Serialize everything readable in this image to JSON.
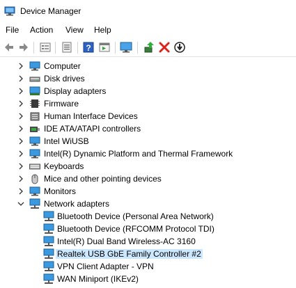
{
  "window": {
    "title": "Device Manager"
  },
  "menu": [
    "File",
    "Action",
    "View",
    "Help"
  ],
  "toolbar": [
    {
      "name": "back-icon"
    },
    {
      "name": "forward-icon"
    },
    {
      "name": "properties-icon"
    },
    {
      "name": "show-hidden-icon"
    },
    {
      "name": "help-icon"
    },
    {
      "name": "action-pane-icon"
    },
    {
      "name": "monitor-icon"
    },
    {
      "name": "update-driver-icon"
    },
    {
      "name": "uninstall-icon"
    },
    {
      "name": "disable-icon"
    }
  ],
  "tree": {
    "categories": [
      {
        "label": "Computer",
        "icon": "computer-icon",
        "expanded": false
      },
      {
        "label": "Disk drives",
        "icon": "disk-drive-icon",
        "expanded": false
      },
      {
        "label": "Display adapters",
        "icon": "display-adapter-icon",
        "expanded": false
      },
      {
        "label": "Firmware",
        "icon": "firmware-icon",
        "expanded": false
      },
      {
        "label": "Human Interface Devices",
        "icon": "hid-icon",
        "expanded": false
      },
      {
        "label": "IDE ATA/ATAPI controllers",
        "icon": "ide-controller-icon",
        "expanded": false
      },
      {
        "label": "Intel WiUSB",
        "icon": "intel-wiusb-icon",
        "expanded": false
      },
      {
        "label": "Intel(R) Dynamic Platform and Thermal Framework",
        "icon": "thermal-framework-icon",
        "expanded": false
      },
      {
        "label": "Keyboards",
        "icon": "keyboard-icon",
        "expanded": false
      },
      {
        "label": "Mice and other pointing devices",
        "icon": "mouse-icon",
        "expanded": false
      },
      {
        "label": "Monitors",
        "icon": "monitor-icon",
        "expanded": false
      },
      {
        "label": "Network adapters",
        "icon": "network-adapter-icon",
        "expanded": true
      }
    ],
    "network_children": [
      {
        "label": "Bluetooth Device (Personal Area Network)",
        "selected": false
      },
      {
        "label": "Bluetooth Device (RFCOMM Protocol TDI)",
        "selected": false
      },
      {
        "label": "Intel(R) Dual Band Wireless-AC 3160",
        "selected": false
      },
      {
        "label": "Realtek USB GbE Family Controller #2",
        "selected": true
      },
      {
        "label": "VPN Client Adapter - VPN",
        "selected": false
      },
      {
        "label": "WAN Miniport (IKEv2)",
        "selected": false
      }
    ]
  },
  "colors": {
    "selection": "#cce8ff",
    "accent": "#2f7fd1",
    "uninstall": "#e0201a"
  }
}
